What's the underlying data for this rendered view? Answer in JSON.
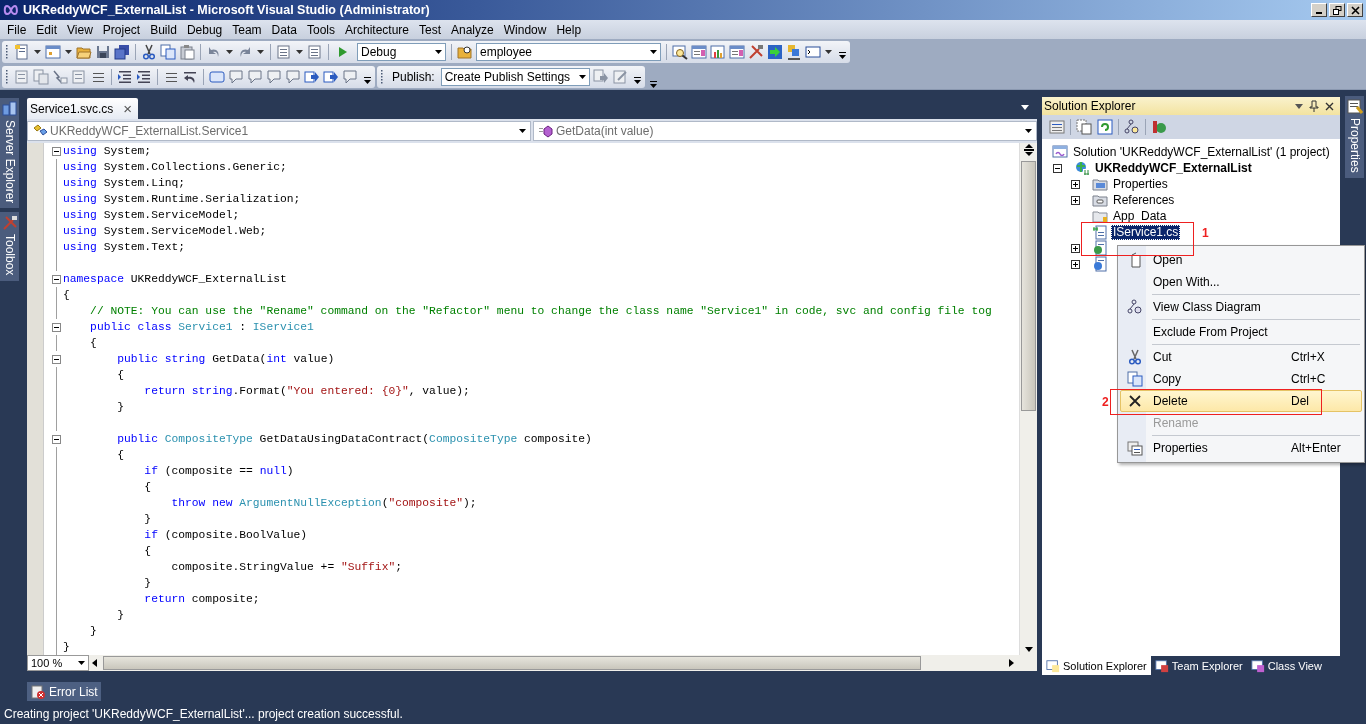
{
  "window": {
    "title": "UKReddyWCF_ExternalList - Microsoft Visual Studio (Administrator)"
  },
  "menu": [
    "File",
    "Edit",
    "View",
    "Project",
    "Build",
    "Debug",
    "Team",
    "Data",
    "Tools",
    "Architecture",
    "Test",
    "Analyze",
    "Window",
    "Help"
  ],
  "toolbar": {
    "configuration": "Debug",
    "find": "employee",
    "publish_label": "Publish:",
    "publish": "Create Publish Settings"
  },
  "side_tabs": [
    "Server Explorer",
    "Toolbox"
  ],
  "right_tabs": [
    "Properties"
  ],
  "editor": {
    "tab": {
      "label": "Service1.svc.cs",
      "close": "×"
    },
    "type_combo": "UKReddyWCF_ExternalList.Service1",
    "member_combo": "GetData(int value)",
    "zoom": "100 %",
    "lines": [
      {
        "fold": true,
        "segments": [
          {
            "kind": "keyword",
            "text": "using"
          },
          {
            "kind": "plain",
            "text": " System;"
          }
        ]
      },
      {
        "fold": false,
        "segments": [
          {
            "kind": "keyword",
            "text": "using"
          },
          {
            "kind": "plain",
            "text": " System.Collections.Generic;"
          }
        ]
      },
      {
        "fold": false,
        "segments": [
          {
            "kind": "keyword",
            "text": "using"
          },
          {
            "kind": "plain",
            "text": " System.Linq;"
          }
        ]
      },
      {
        "fold": false,
        "segments": [
          {
            "kind": "keyword",
            "text": "using"
          },
          {
            "kind": "plain",
            "text": " System.Runtime.Serialization;"
          }
        ]
      },
      {
        "fold": false,
        "segments": [
          {
            "kind": "keyword",
            "text": "using"
          },
          {
            "kind": "plain",
            "text": " System.ServiceModel;"
          }
        ]
      },
      {
        "fold": false,
        "segments": [
          {
            "kind": "keyword",
            "text": "using"
          },
          {
            "kind": "plain",
            "text": " System.ServiceModel.Web;"
          }
        ]
      },
      {
        "fold": false,
        "segments": [
          {
            "kind": "keyword",
            "text": "using"
          },
          {
            "kind": "plain",
            "text": " System.Text;"
          }
        ]
      },
      {
        "fold": false
      },
      {
        "fold": true,
        "segments": [
          {
            "kind": "keyword",
            "text": "namespace"
          },
          {
            "kind": "plain",
            "text": " UKReddyWCF_ExternalList"
          }
        ]
      },
      {
        "fold": false,
        "segments": [
          {
            "kind": "plain",
            "text": "{"
          }
        ]
      },
      {
        "fold": false,
        "segments": [
          {
            "kind": "comment",
            "text": "    // NOTE: You can use the \"Rename\" command on the \"Refactor\" menu to change the class name \"Service1\" in code, svc and config file tog"
          }
        ]
      },
      {
        "fold": true,
        "segments": [
          {
            "kind": "keyword",
            "text": "    public class "
          },
          {
            "kind": "type",
            "text": "Service1"
          },
          {
            "kind": "plain",
            "text": " : "
          },
          {
            "kind": "type",
            "text": "IService1"
          }
        ]
      },
      {
        "fold": false,
        "segments": [
          {
            "kind": "plain",
            "text": "    {"
          }
        ]
      },
      {
        "fold": true,
        "segments": [
          {
            "kind": "keyword",
            "text": "        public string"
          },
          {
            "kind": "plain",
            "text": " GetData("
          },
          {
            "kind": "keyword",
            "text": "int"
          },
          {
            "kind": "plain",
            "text": " value)"
          }
        ]
      },
      {
        "fold": false,
        "segments": [
          {
            "kind": "plain",
            "text": "        {"
          }
        ]
      },
      {
        "fold": false,
        "segments": [
          {
            "kind": "keyword",
            "text": "            return string"
          },
          {
            "kind": "plain",
            "text": ".Format("
          },
          {
            "kind": "string",
            "text": "\"You entered: {0}\""
          },
          {
            "kind": "plain",
            "text": ", value);"
          }
        ]
      },
      {
        "fold": false,
        "segments": [
          {
            "kind": "plain",
            "text": "        }"
          }
        ]
      },
      {
        "fold": false
      },
      {
        "fold": true,
        "segments": [
          {
            "kind": "keyword",
            "text": "        public "
          },
          {
            "kind": "type",
            "text": "CompositeType"
          },
          {
            "kind": "plain",
            "text": " GetDataUsingDataContract("
          },
          {
            "kind": "type",
            "text": "CompositeType"
          },
          {
            "kind": "plain",
            "text": " composite)"
          }
        ]
      },
      {
        "fold": false,
        "segments": [
          {
            "kind": "plain",
            "text": "        {"
          }
        ]
      },
      {
        "fold": false,
        "segments": [
          {
            "kind": "keyword",
            "text": "            if"
          },
          {
            "kind": "plain",
            "text": " (composite == "
          },
          {
            "kind": "keyword",
            "text": "null"
          },
          {
            "kind": "plain",
            "text": ")"
          }
        ]
      },
      {
        "fold": false,
        "segments": [
          {
            "kind": "plain",
            "text": "            {"
          }
        ]
      },
      {
        "fold": false,
        "segments": [
          {
            "kind": "keyword",
            "text": "                throw new "
          },
          {
            "kind": "type",
            "text": "ArgumentNullException"
          },
          {
            "kind": "plain",
            "text": "("
          },
          {
            "kind": "string",
            "text": "\"composite\""
          },
          {
            "kind": "plain",
            "text": ");"
          }
        ]
      },
      {
        "fold": false,
        "segments": [
          {
            "kind": "plain",
            "text": "            }"
          }
        ]
      },
      {
        "fold": false,
        "segments": [
          {
            "kind": "keyword",
            "text": "            if"
          },
          {
            "kind": "plain",
            "text": " (composite.BoolValue)"
          }
        ]
      },
      {
        "fold": false,
        "segments": [
          {
            "kind": "plain",
            "text": "            {"
          }
        ]
      },
      {
        "fold": false,
        "segments": [
          {
            "kind": "plain",
            "text": "                composite.StringValue += "
          },
          {
            "kind": "string",
            "text": "\"Suffix\""
          },
          {
            "kind": "plain",
            "text": ";"
          }
        ]
      },
      {
        "fold": false,
        "segments": [
          {
            "kind": "plain",
            "text": "            }"
          }
        ]
      },
      {
        "fold": false,
        "segments": [
          {
            "kind": "keyword",
            "text": "            return"
          },
          {
            "kind": "plain",
            "text": " composite;"
          }
        ]
      },
      {
        "fold": false,
        "segments": [
          {
            "kind": "plain",
            "text": "        }"
          }
        ]
      },
      {
        "fold": false,
        "segments": [
          {
            "kind": "plain",
            "text": "    }"
          }
        ]
      },
      {
        "fold": false,
        "segments": [
          {
            "kind": "plain",
            "text": "}"
          }
        ]
      }
    ]
  },
  "solution_explorer": {
    "title": "Solution Explorer",
    "tree": [
      {
        "label": "Solution 'UKReddyWCF_ExternalList' (1 project)",
        "kind": "solution",
        "selected": false,
        "children": [
          {
            "label": "UKReddyWCF_ExternalList",
            "kind": "project",
            "selected": false,
            "expanded": true,
            "children": [
              {
                "label": "Properties",
                "kind": "properties",
                "selected": false,
                "expanded": false
              },
              {
                "label": "References",
                "kind": "references",
                "selected": false,
                "expanded": false
              },
              {
                "label": "App_Data",
                "kind": "folder",
                "selected": false
              },
              {
                "label": "IService1.cs",
                "kind": "cs",
                "selected": true
              },
              {
                "kind": "svc",
                "expanded": false
              },
              {
                "kind": "config",
                "expanded": false
              }
            ]
          }
        ]
      }
    ],
    "bottom_tabs": [
      {
        "label": "Solution Explorer",
        "selected": true
      },
      {
        "label": "Team Explorer",
        "selected": false
      },
      {
        "label": "Class View",
        "selected": false
      }
    ]
  },
  "context_menu": [
    {
      "kind": "item",
      "label": "Open",
      "disabled": false,
      "selected": false
    },
    {
      "kind": "item",
      "label": "Open With...",
      "disabled": false,
      "selected": false
    },
    {
      "kind": "separator"
    },
    {
      "kind": "item",
      "label": "View Class Diagram",
      "disabled": false,
      "selected": false
    },
    {
      "kind": "separator"
    },
    {
      "kind": "item",
      "label": "Exclude From Project",
      "disabled": false,
      "selected": false
    },
    {
      "kind": "separator"
    },
    {
      "kind": "item",
      "label": "Cut",
      "shortcut": "Ctrl+X",
      "disabled": false,
      "selected": false
    },
    {
      "kind": "item",
      "label": "Copy",
      "shortcut": "Ctrl+C",
      "disabled": false,
      "selected": false
    },
    {
      "kind": "item",
      "label": "Delete",
      "shortcut": "Del",
      "disabled": false,
      "selected": true
    },
    {
      "kind": "item",
      "label": "Rename",
      "disabled": true,
      "selected": false
    },
    {
      "kind": "separator"
    },
    {
      "kind": "item",
      "label": "Properties",
      "shortcut": "Alt+Enter",
      "disabled": false,
      "selected": false
    }
  ],
  "annotations": [
    "1",
    "2"
  ],
  "bottom_panel": {
    "tab": "Error List"
  },
  "status_bar": "Creating project 'UKReddyWCF_ExternalList'... project creation successful."
}
